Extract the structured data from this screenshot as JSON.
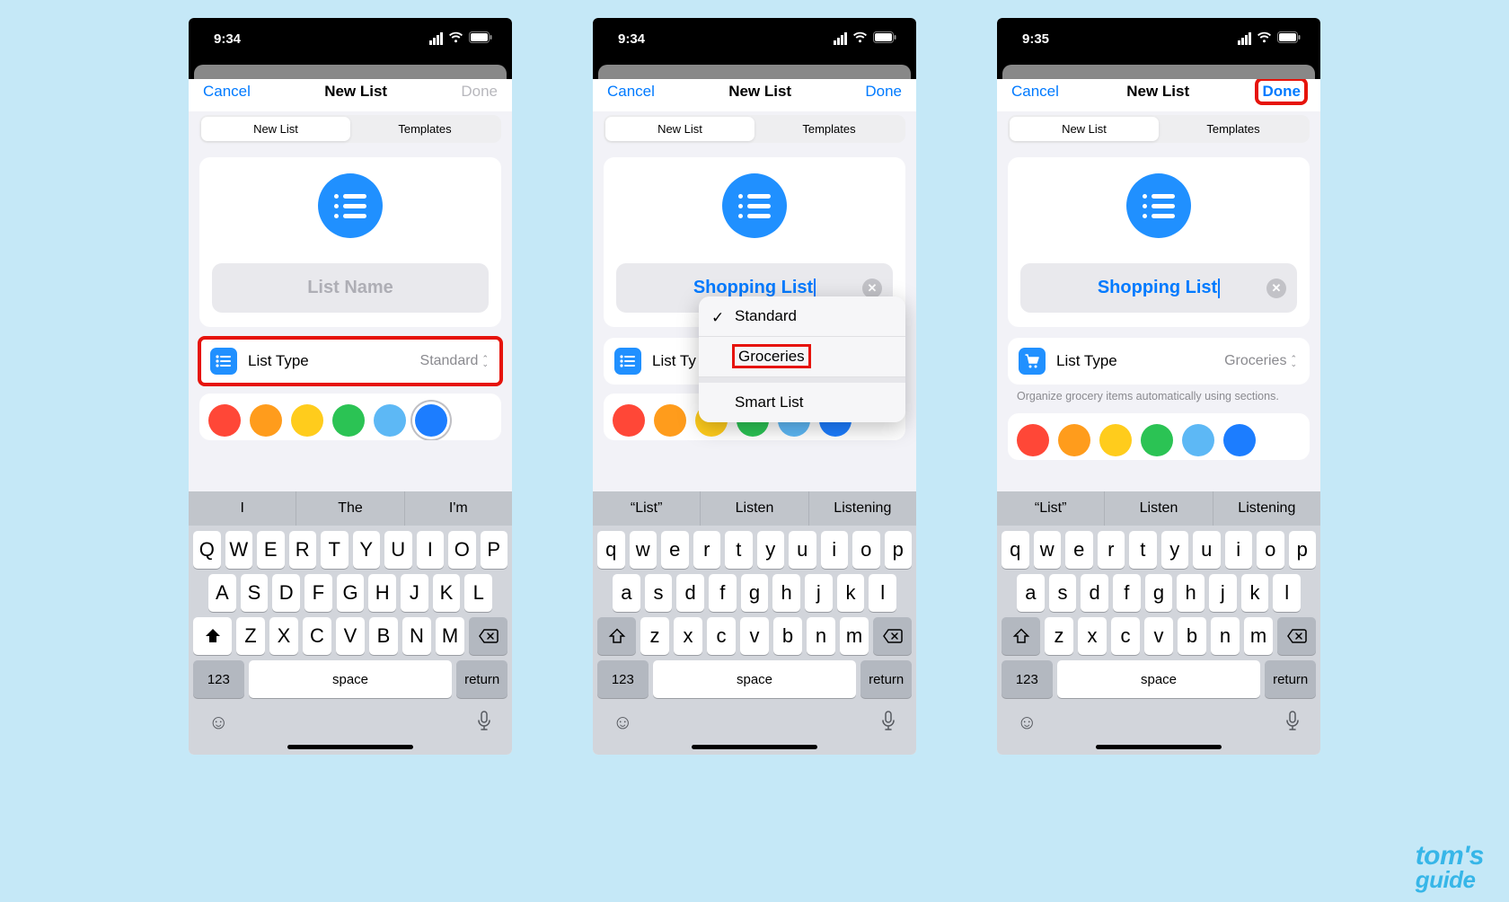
{
  "watermark": {
    "line1": "tom's",
    "line2": "guide"
  },
  "colors": {
    "swatches": [
      "#ff4737",
      "#ff9c1c",
      "#ffcc1c",
      "#2bc354",
      "#5db8f5",
      "#1c7dff"
    ],
    "selected_index_1": 5
  },
  "keyboard": {
    "upper": {
      "row1": [
        "Q",
        "W",
        "E",
        "R",
        "T",
        "Y",
        "U",
        "I",
        "O",
        "P"
      ],
      "row2": [
        "A",
        "S",
        "D",
        "F",
        "G",
        "H",
        "J",
        "K",
        "L"
      ],
      "row3": [
        "Z",
        "X",
        "C",
        "V",
        "B",
        "N",
        "M"
      ]
    },
    "lower": {
      "row1": [
        "q",
        "w",
        "e",
        "r",
        "t",
        "y",
        "u",
        "i",
        "o",
        "p"
      ],
      "row2": [
        "a",
        "s",
        "d",
        "f",
        "g",
        "h",
        "j",
        "k",
        "l"
      ],
      "row3": [
        "z",
        "x",
        "c",
        "v",
        "b",
        "n",
        "m"
      ]
    },
    "fn123": "123",
    "space": "space",
    "return": "return"
  },
  "screens": [
    {
      "time": "9:34",
      "nav": {
        "cancel": "Cancel",
        "title": "New List",
        "done": "Done",
        "done_enabled": false
      },
      "segmented": {
        "left": "New List",
        "right": "Templates"
      },
      "name": {
        "value": "",
        "placeholder": "List Name",
        "has_text": false
      },
      "list_type": {
        "label": "List Type",
        "value": "Standard",
        "highlight": true,
        "icon_color": "blue"
      },
      "predictions": [
        "I",
        "The",
        "I'm"
      ],
      "keyboard_case": "upper",
      "shift_filled": true
    },
    {
      "time": "9:34",
      "nav": {
        "cancel": "Cancel",
        "title": "New List",
        "done": "Done",
        "done_enabled": true
      },
      "segmented": {
        "left": "New List",
        "right": "Templates"
      },
      "name": {
        "value": "Shopping List",
        "placeholder": "List Name",
        "has_text": true
      },
      "list_type": {
        "label": "List Ty",
        "value": "",
        "highlight": false,
        "icon_color": "blue"
      },
      "dropdown": {
        "items": [
          "Standard",
          "Groceries",
          "Smart List"
        ],
        "checked_index": 0,
        "highlight_index": 1
      },
      "predictions": [
        "“List”",
        "Listen",
        "Listening"
      ],
      "keyboard_case": "lower",
      "shift_filled": false
    },
    {
      "time": "9:35",
      "nav": {
        "cancel": "Cancel",
        "title": "New List",
        "done": "Done",
        "done_enabled": true,
        "done_highlight": true
      },
      "segmented": {
        "left": "New List",
        "right": "Templates"
      },
      "name": {
        "value": "Shopping List",
        "placeholder": "List Name",
        "has_text": true
      },
      "list_type": {
        "label": "List Type",
        "value": "Groceries",
        "highlight": false,
        "icon_color": "blue",
        "icon_variant": "cart"
      },
      "help_text": "Organize grocery items automatically using sections.",
      "predictions": [
        "“List”",
        "Listen",
        "Listening"
      ],
      "keyboard_case": "lower",
      "shift_filled": false
    }
  ]
}
